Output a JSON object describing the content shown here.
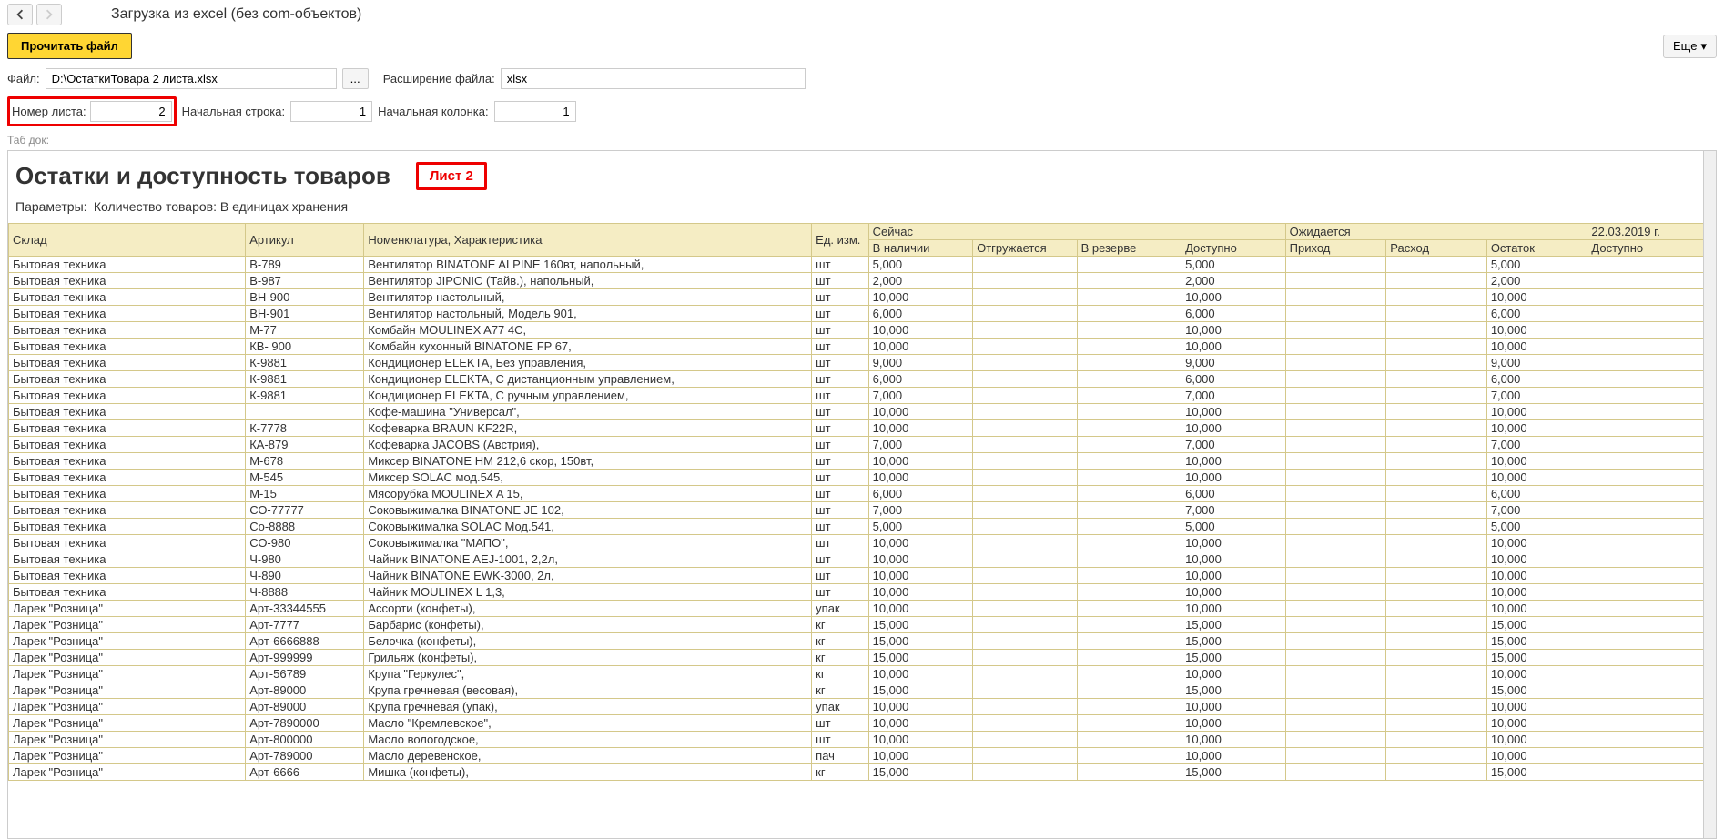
{
  "header": {
    "title": "Загрузка из excel (без com-объектов)"
  },
  "toolbar": {
    "read_file": "Прочитать файл",
    "more": "Еще"
  },
  "form": {
    "file_label": "Файл:",
    "file_value": "D:\\ОстаткиТовара 2 листа.xlsx",
    "ellipsis": "...",
    "ext_label": "Расширение файла:",
    "ext_value": "xlsx",
    "sheet_label": "Номер листа:",
    "sheet_value": "2",
    "start_row_label": "Начальная строка:",
    "start_row_value": "1",
    "start_col_label": "Начальная колонка:",
    "start_col_value": "1",
    "tab_doc_label": "Таб док:"
  },
  "document": {
    "title": "Остатки и доступность товаров",
    "sheet_badge": "Лист 2",
    "params_label": "Параметры:",
    "params_value": "Количество товаров: В единицах хранения",
    "columns": {
      "sklad": "Склад",
      "artikul": "Артикул",
      "nomenklatura": "Номенклатура, Характеристика",
      "ed": "Ед. изм.",
      "now_group": "Сейчас",
      "nalichii": "В наличии",
      "otgruz": "Отгружается",
      "rezerv": "В резерве",
      "dostupno": "Доступно",
      "expect_group": "Ожидается",
      "prihod": "Приход",
      "rashod": "Расход",
      "ostatok": "Остаток",
      "date_group": "22.03.2019 г.",
      "dostupno2": "Доступно"
    },
    "rows": [
      {
        "sklad": "Бытовая техника",
        "art": "В-789",
        "nom": "Вентилятор BINATONE ALPINE 160вт, напольный,",
        "ed": "шт",
        "v1": "5,000",
        "v4": "5,000",
        "v7": "5,000"
      },
      {
        "sklad": "Бытовая техника",
        "art": "В-987",
        "nom": "Вентилятор JIPONIC (Тайв.), напольный,",
        "ed": "шт",
        "v1": "2,000",
        "v4": "2,000",
        "v7": "2,000"
      },
      {
        "sklad": "Бытовая техника",
        "art": "ВН-900",
        "nom": "Вентилятор настольный,",
        "ed": "шт",
        "v1": "10,000",
        "v4": "10,000",
        "v7": "10,000"
      },
      {
        "sklad": "Бытовая техника",
        "art": "ВН-901",
        "nom": "Вентилятор настольный, Модель 901,",
        "ed": "шт",
        "v1": "6,000",
        "v4": "6,000",
        "v7": "6,000"
      },
      {
        "sklad": "Бытовая техника",
        "art": "М-77",
        "nom": "Комбайн MOULINEX A77 4C,",
        "ed": "шт",
        "v1": "10,000",
        "v4": "10,000",
        "v7": "10,000"
      },
      {
        "sklad": "Бытовая техника",
        "art": "КВ- 900",
        "nom": "Комбайн кухонный BINATONE FP 67,",
        "ed": "шт",
        "v1": "10,000",
        "v4": "10,000",
        "v7": "10,000"
      },
      {
        "sklad": "Бытовая техника",
        "art": "К-9881",
        "nom": "Кондиционер ELEKTA, Без управления,",
        "ed": "шт",
        "v1": "9,000",
        "v4": "9,000",
        "v7": "9,000"
      },
      {
        "sklad": "Бытовая техника",
        "art": "К-9881",
        "nom": "Кондиционер ELEKTA, С дистанционным управлением,",
        "ed": "шт",
        "v1": "6,000",
        "v4": "6,000",
        "v7": "6,000"
      },
      {
        "sklad": "Бытовая техника",
        "art": "К-9881",
        "nom": "Кондиционер ELEKTA, С ручным управлением,",
        "ed": "шт",
        "v1": "7,000",
        "v4": "7,000",
        "v7": "7,000"
      },
      {
        "sklad": "Бытовая техника",
        "art": "",
        "nom": "Кофе-машина \"Универсал\",",
        "ed": "шт",
        "v1": "10,000",
        "v4": "10,000",
        "v7": "10,000"
      },
      {
        "sklad": "Бытовая техника",
        "art": "К-7778",
        "nom": "Кофеварка BRAUN KF22R,",
        "ed": "шт",
        "v1": "10,000",
        "v4": "10,000",
        "v7": "10,000"
      },
      {
        "sklad": "Бытовая техника",
        "art": "КА-879",
        "nom": "Кофеварка JACOBS (Австрия),",
        "ed": "шт",
        "v1": "7,000",
        "v4": "7,000",
        "v7": "7,000"
      },
      {
        "sklad": "Бытовая техника",
        "art": "М-678",
        "nom": "Миксер BINATONE HM 212,6 скор, 150вт,",
        "ed": "шт",
        "v1": "10,000",
        "v4": "10,000",
        "v7": "10,000"
      },
      {
        "sklad": "Бытовая техника",
        "art": "М-545",
        "nom": "Миксер SOLAC мод.545,",
        "ed": "шт",
        "v1": "10,000",
        "v4": "10,000",
        "v7": "10,000"
      },
      {
        "sklad": "Бытовая техника",
        "art": "М-15",
        "nom": "Мясорубка MOULINEX A 15,",
        "ed": "шт",
        "v1": "6,000",
        "v4": "6,000",
        "v7": "6,000"
      },
      {
        "sklad": "Бытовая техника",
        "art": "СО-77777",
        "nom": "Соковыжималка BINATONE JE 102,",
        "ed": "шт",
        "v1": "7,000",
        "v4": "7,000",
        "v7": "7,000"
      },
      {
        "sklad": "Бытовая техника",
        "art": "Со-8888",
        "nom": "Соковыжималка SOLAC Мод.541,",
        "ed": "шт",
        "v1": "5,000",
        "v4": "5,000",
        "v7": "5,000"
      },
      {
        "sklad": "Бытовая техника",
        "art": "СО-980",
        "nom": "Соковыжималка \"МАПО\",",
        "ed": "шт",
        "v1": "10,000",
        "v4": "10,000",
        "v7": "10,000"
      },
      {
        "sklad": "Бытовая техника",
        "art": "Ч-980",
        "nom": "Чайник BINATONE AEJ-1001, 2,2л,",
        "ed": "шт",
        "v1": "10,000",
        "v4": "10,000",
        "v7": "10,000"
      },
      {
        "sklad": "Бытовая техника",
        "art": "Ч-890",
        "nom": "Чайник BINATONE EWK-3000, 2л,",
        "ed": "шт",
        "v1": "10,000",
        "v4": "10,000",
        "v7": "10,000"
      },
      {
        "sklad": "Бытовая техника",
        "art": "Ч-8888",
        "nom": "Чайник MOULINEX L 1,3,",
        "ed": "шт",
        "v1": "10,000",
        "v4": "10,000",
        "v7": "10,000"
      },
      {
        "sklad": "Ларек \"Розница\"",
        "art": "Арт-33344555",
        "nom": "Ассорти (конфеты),",
        "ed": "упак",
        "v1": "10,000",
        "v4": "10,000",
        "v7": "10,000"
      },
      {
        "sklad": "Ларек \"Розница\"",
        "art": "Арт-7777",
        "nom": "Барбарис (конфеты),",
        "ed": "кг",
        "v1": "15,000",
        "v4": "15,000",
        "v7": "15,000"
      },
      {
        "sklad": "Ларек \"Розница\"",
        "art": "Арт-6666888",
        "nom": "Белочка (конфеты),",
        "ed": "кг",
        "v1": "15,000",
        "v4": "15,000",
        "v7": "15,000"
      },
      {
        "sklad": "Ларек \"Розница\"",
        "art": "Арт-999999",
        "nom": "Грильяж (конфеты),",
        "ed": "кг",
        "v1": "15,000",
        "v4": "15,000",
        "v7": "15,000"
      },
      {
        "sklad": "Ларек \"Розница\"",
        "art": "Арт-56789",
        "nom": "Крупа \"Геркулес\",",
        "ed": "кг",
        "v1": "10,000",
        "v4": "10,000",
        "v7": "10,000"
      },
      {
        "sklad": "Ларек \"Розница\"",
        "art": "Арт-89000",
        "nom": "Крупа гречневая (весовая),",
        "ed": "кг",
        "v1": "15,000",
        "v4": "15,000",
        "v7": "15,000"
      },
      {
        "sklad": "Ларек \"Розница\"",
        "art": "Арт-89000",
        "nom": "Крупа гречневая (упак),",
        "ed": "упак",
        "v1": "10,000",
        "v4": "10,000",
        "v7": "10,000"
      },
      {
        "sklad": "Ларек \"Розница\"",
        "art": "Арт-7890000",
        "nom": "Масло \"Кремлевское\",",
        "ed": "шт",
        "v1": "10,000",
        "v4": "10,000",
        "v7": "10,000"
      },
      {
        "sklad": "Ларек \"Розница\"",
        "art": "Арт-800000",
        "nom": "Масло вологодское,",
        "ed": "шт",
        "v1": "10,000",
        "v4": "10,000",
        "v7": "10,000"
      },
      {
        "sklad": "Ларек \"Розница\"",
        "art": "Арт-789000",
        "nom": "Масло деревенское,",
        "ed": "пач",
        "v1": "10,000",
        "v4": "10,000",
        "v7": "10,000"
      },
      {
        "sklad": "Ларек \"Розница\"",
        "art": "Арт-6666",
        "nom": "Мишка (конфеты),",
        "ed": "кг",
        "v1": "15,000",
        "v4": "15,000",
        "v7": "15,000"
      }
    ]
  }
}
